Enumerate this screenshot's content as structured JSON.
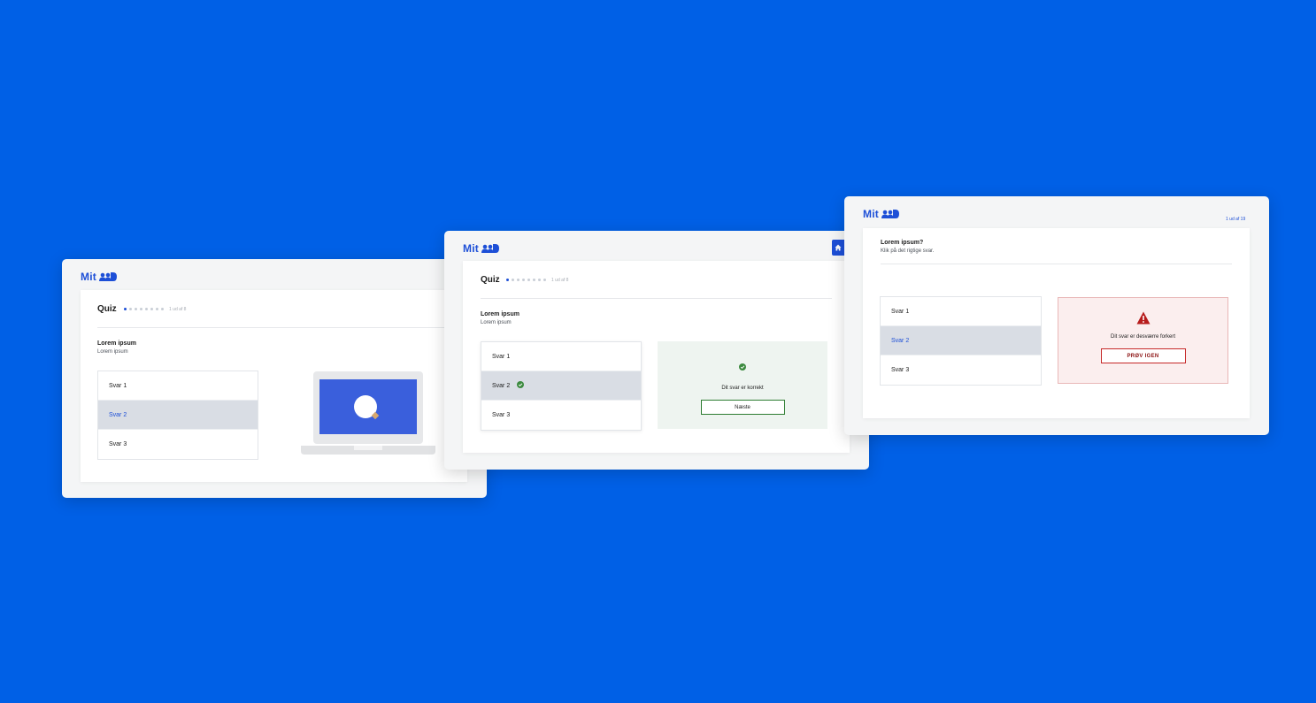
{
  "brand": {
    "logo_text": "Mit",
    "logo_icon": "mitid-logo-icon",
    "accent": "#1d4fd7",
    "background": "#0060e6"
  },
  "screen1": {
    "quiz_label": "Quiz",
    "counter": "1 ud af 8",
    "question_title": "Lorem ipsum",
    "question_sub": "Lorem ipsum",
    "answers": [
      "Svar 1",
      "Svar 2",
      "Svar 3"
    ],
    "selected_index": 1,
    "illustration": "laptop-search-icon"
  },
  "screen2": {
    "quiz_label": "Quiz",
    "counter": "1 ud af 8",
    "question_title": "Lorem ipsum",
    "question_sub": "Lorem ipsum",
    "answers": [
      "Svar 1",
      "Svar 2",
      "Svar 3"
    ],
    "selected_index": 1,
    "feedback_text": "Dit svar er korrekt",
    "next_button": "Næste",
    "status_color": "#2e7d32",
    "home_icon": "home-icon"
  },
  "screen3": {
    "counter": "1 ud af 19",
    "question_title": "Lorem ipsum?",
    "question_sub": "Klik på det rigtige svar.",
    "answers": [
      "Svar 1",
      "Svar 2",
      "Svar 3"
    ],
    "selected_index": 1,
    "feedback_text": "Dit svar er desværre forkert",
    "retry_button": "PRØV IGEN",
    "status_color": "#c62828"
  }
}
